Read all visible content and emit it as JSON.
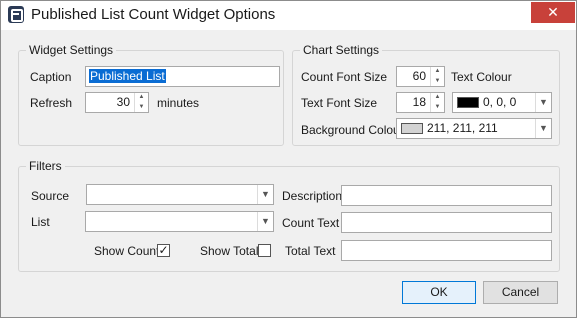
{
  "window": {
    "title": "Published List Count Widget Options",
    "close_glyph": "✕"
  },
  "widget_settings": {
    "legend": "Widget Settings",
    "caption_label": "Caption",
    "caption_value": "Published List",
    "refresh_label": "Refresh",
    "refresh_value": "30",
    "refresh_unit": "minutes"
  },
  "chart_settings": {
    "legend": "Chart Settings",
    "count_font_size_label": "Count Font Size",
    "count_font_size_value": "60",
    "text_colour_label": "Text Colour",
    "text_font_size_label": "Text Font Size",
    "text_font_size_value": "18",
    "text_colour_value": "0, 0, 0",
    "text_colour_swatch": "#000000",
    "background_colour_label": "Background Colour",
    "background_colour_value": "211, 211, 211",
    "background_colour_swatch": "#d3d3d3"
  },
  "filters": {
    "legend": "Filters",
    "source_label": "Source",
    "source_value": "",
    "list_label": "List",
    "list_value": "",
    "description_label": "Description",
    "description_value": "",
    "count_text_label": "Count Text",
    "count_text_value": "",
    "total_text_label": "Total Text",
    "total_text_value": "",
    "show_count_label": "Show Count",
    "show_count_checked": true,
    "show_count_glyph": "✓",
    "show_total_label": "Show Total",
    "show_total_checked": false
  },
  "buttons": {
    "ok": "OK",
    "cancel": "Cancel"
  },
  "glyphs": {
    "spin_up": "▲",
    "spin_down": "▼",
    "dropdown": "▼"
  },
  "colors": {
    "accent": "#0078d7",
    "close": "#c8413a",
    "selection": "#0a6cd3"
  }
}
